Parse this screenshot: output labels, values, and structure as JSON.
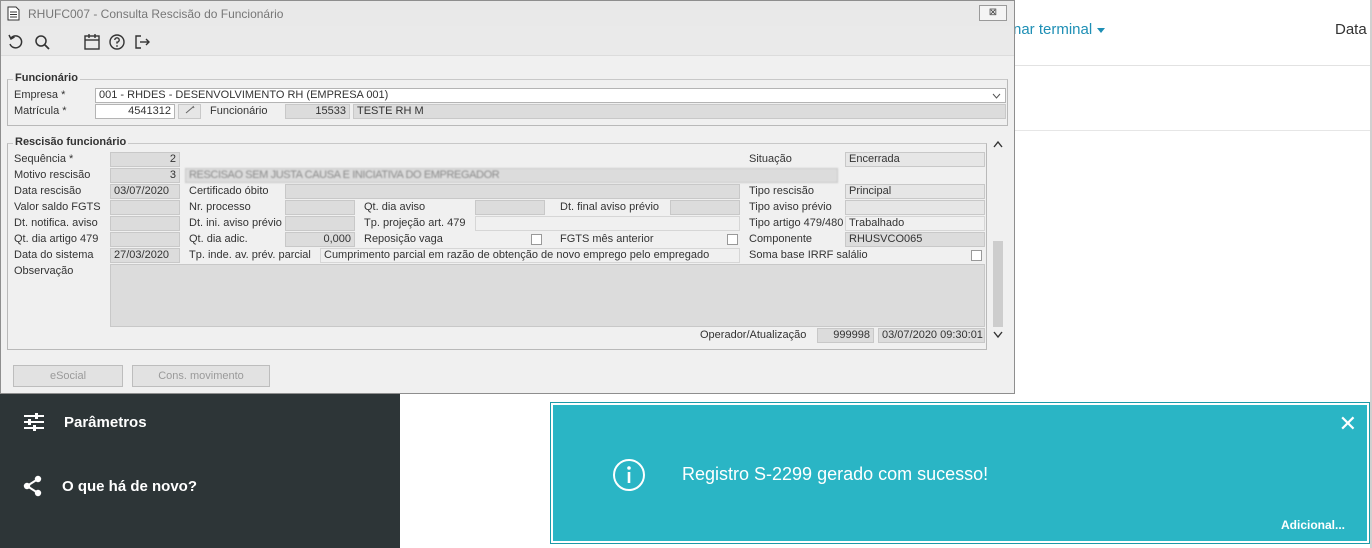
{
  "background": {
    "menu_terminal": "nar terminal",
    "menu_data": "Data d",
    "sidebar": [
      {
        "label": "Parâmetros",
        "icon": "sliders-icon"
      },
      {
        "label": "O que há de novo?",
        "icon": "share-icon"
      }
    ],
    "toast": {
      "message": "Registro S-2299 gerado com sucesso!",
      "more": "Adicional...",
      "close": "✕",
      "color": "#2ab5c5"
    }
  },
  "dialog": {
    "title": "RHUFC007 - Consulta Rescisão do Funcionário",
    "close": "⊠",
    "toolbar": [
      "undo-icon",
      "search-icon",
      "calendar-icon",
      "help-icon",
      "exit-icon"
    ],
    "funcionario": {
      "group_title": "Funcionário",
      "empresa_label": "Empresa *",
      "empresa_value": "001 - RHDES - DESENVOLVIMENTO RH (EMPRESA 001)",
      "matricula_label": "Matrícula *",
      "matricula_value": "4541312",
      "funcionario_label": "Funcionário",
      "funcionario_code": "15533",
      "funcionario_name": "TESTE RH M"
    },
    "rescisao": {
      "group_title": "Rescisão funcionário",
      "sequencia_label": "Sequência *",
      "sequencia_value": "2",
      "motivo_label": "Motivo rescisão",
      "motivo_value": "3",
      "motivo_desc": "RESCISAO SEM JUSTA CAUSA E INICIATIVA DO EMPREGADOR",
      "data_rescisao_label": "Data rescisão",
      "data_rescisao_value": "03/07/2020",
      "valor_saldo_label": "Valor saldo FGTS",
      "dt_notifica_label": "Dt. notifica. aviso",
      "qt_dia_artigo_label": "Qt. dia artigo 479",
      "data_sistema_label": "Data do sistema",
      "data_sistema_value": "27/03/2020",
      "observacao_label": "Observação",
      "certificado_label": "Certificado óbito",
      "nr_processo_label": "Nr. processo",
      "dt_ini_aviso_label": "Dt. ini. aviso prévio",
      "qt_dia_adic_label": "Qt. dia adic.",
      "qt_dia_adic_value": "0,000",
      "tp_inde_label": "Tp. inde. av. prév. parcial",
      "tp_inde_value": "Cumprimento parcial em razão de obtenção de novo emprego pelo empregado",
      "qt_dia_aviso_label": "Qt. dia aviso",
      "dt_final_aviso_label": "Dt. final aviso prévio",
      "tp_projecao_label": "Tp. projeção art. 479",
      "reposicao_label": "Reposição vaga",
      "fgts_mes_label": "FGTS mês anterior",
      "situacao_label": "Situação",
      "situacao_value": "Encerrada",
      "tipo_rescisao_label": "Tipo rescisão",
      "tipo_rescisao_value": "Principal",
      "tipo_aviso_label": "Tipo aviso prévio",
      "tipo_artigo_label": "Tipo artigo 479/480",
      "tipo_artigo_value": "Trabalhado",
      "componente_label": "Componente",
      "componente_value": "RHUSVCO065",
      "soma_base_label": "Soma base IRRF salálio",
      "operador_label": "Operador/Atualização",
      "operador_value": "999998",
      "atualizacao_value": "03/07/2020 09:30:01"
    },
    "buttons": {
      "esocial": "eSocial",
      "cons_movimento": "Cons. movimento"
    }
  }
}
